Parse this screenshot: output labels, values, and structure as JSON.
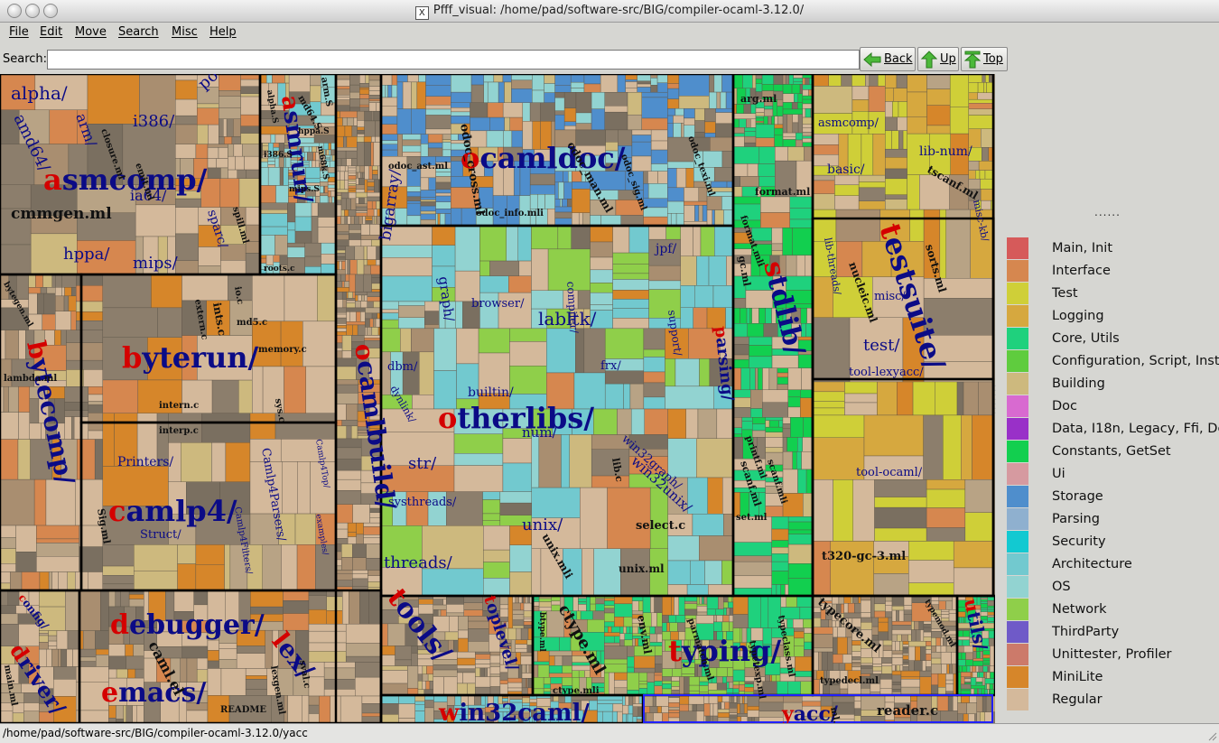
{
  "window": {
    "title": "Pfff_visual: /home/pad/software-src/BIG/compiler-ocaml-3.12.0/",
    "x_icon_glyph": "X"
  },
  "menubar": [
    "File",
    "Edit",
    "Move",
    "Search",
    "Misc",
    "Help"
  ],
  "toolbar": {
    "search_label": "Search:",
    "search_value": "",
    "back_label": "Back",
    "up_label": "Up",
    "top_label": "Top"
  },
  "colors": {
    "treemap_border": "#000000",
    "dir_label": "#0b0b86",
    "dir_initial": "#d40000",
    "selection_outline": "#2020ff"
  },
  "legend": {
    "dots": "......",
    "items": [
      {
        "label": "Main, Init",
        "color": "#d65a5a"
      },
      {
        "label": "Interface",
        "color": "#d6874f"
      },
      {
        "label": "Test",
        "color": "#cfcf38"
      },
      {
        "label": "Logging",
        "color": "#d6a83f"
      },
      {
        "label": "Core, Utils",
        "color": "#1fd17d"
      },
      {
        "label": "Configuration, Script, Install",
        "color": "#5fcc3e"
      },
      {
        "label": "Building",
        "color": "#cdb97e"
      },
      {
        "label": "Doc",
        "color": "#d86ad0"
      },
      {
        "label": "Data, I18n, Legacy, Ffi, Dead",
        "color": "#9930c8"
      },
      {
        "label": "Constants, GetSet",
        "color": "#12cf4f"
      },
      {
        "label": "Ui",
        "color": "#d69aa0"
      },
      {
        "label": "Storage",
        "color": "#4f8ecc"
      },
      {
        "label": "Parsing",
        "color": "#8fb0cf"
      },
      {
        "label": "Security",
        "color": "#12c9d1"
      },
      {
        "label": "Architecture",
        "color": "#72c9cf"
      },
      {
        "label": "OS",
        "color": "#92d3d1"
      },
      {
        "label": "Network",
        "color": "#8fcf4a"
      },
      {
        "label": "ThirdParty",
        "color": "#6f5ac8"
      },
      {
        "label": "Unittester, Profiler",
        "color": "#cc7a6a"
      },
      {
        "label": "MiniLite",
        "color": "#d6862a"
      },
      {
        "label": "Regular",
        "color": "#d4b99b"
      }
    ]
  },
  "treemap": {
    "directories": [
      {
        "label": "asmcomp/",
        "initial": "a",
        "rest": "smcomp/"
      },
      {
        "label": "bytecomp/",
        "initial": "b",
        "rest": "ytecomp/"
      },
      {
        "label": "byterun/",
        "initial": "b",
        "rest": "yterun/"
      },
      {
        "label": "camlp4/",
        "initial": "c",
        "rest": "amlp4/"
      },
      {
        "label": "debugger/",
        "initial": "d",
        "rest": "ebugger/"
      },
      {
        "label": "emacs/",
        "initial": "e",
        "rest": "macs/"
      },
      {
        "label": "ocamlbuild/",
        "initial": "o",
        "rest": "camlbuild/"
      },
      {
        "label": "ocamldoc/",
        "initial": "o",
        "rest": "camldoc/"
      },
      {
        "label": "otherlibs/",
        "initial": "o",
        "rest": "therlibs/"
      },
      {
        "label": "stdlib/",
        "initial": "s",
        "rest": "tdlib/"
      },
      {
        "label": "testsuite/",
        "initial": "t",
        "rest": "estsuite/"
      },
      {
        "label": "tools/",
        "initial": "t",
        "rest": "ools/"
      },
      {
        "label": "typing/",
        "initial": "t",
        "rest": "yping/"
      },
      {
        "label": "driver/",
        "initial": "d",
        "rest": "river/"
      },
      {
        "label": "lex/",
        "initial": "l",
        "rest": "ex/"
      },
      {
        "label": "toplevel/",
        "initial": "t",
        "rest": "oplevel/"
      },
      {
        "label": "utils/",
        "initial": "u",
        "rest": "tils/"
      },
      {
        "label": "win32caml/",
        "initial": "w",
        "rest": "in32caml/"
      },
      {
        "label": "yacc/",
        "initial": "y",
        "rest": "acc/"
      },
      {
        "label": "parsing/",
        "initial": "p",
        "rest": "arsing/"
      },
      {
        "label": "asmrun/",
        "initial": "a",
        "rest": "smrun/"
      },
      {
        "label": "config/",
        "initial": "c",
        "rest": "onfig/"
      }
    ],
    "subdirs": [
      "alpha/",
      "amd64/",
      "arm/",
      "i386/",
      "power/",
      "ia64/",
      "hppa/",
      "mips/",
      "sparc/",
      "bigarray/",
      "graph/",
      "dbm/",
      "dynlink/",
      "labltk/",
      "browser/",
      "compiler/",
      "jpf/",
      "support/",
      "frx/",
      "builtin/",
      "num/",
      "str/",
      "systhreads/",
      "threads/",
      "unix/",
      "win32unix/",
      "win32graph/",
      "lib-num/",
      "basic/",
      "asmcomp/",
      "lib-threads/",
      "misc-kb/",
      "tool-lexyacc/",
      "tool-ocaml/",
      "Camlp4Parsers/",
      "Camlp4Filters/",
      "Camlp4Top/",
      "Printers/",
      "Struct/",
      "examples/",
      "misc/",
      "test/"
    ],
    "files": [
      "cmmgen.ml",
      "closure.ml",
      "emit.ml",
      "spill.ml",
      "roots.c",
      "arm.S",
      "md64.S",
      "alpha.S",
      "hppa.S",
      "i386.S",
      "m68k.S",
      "mips.S",
      "odoc_ast.ml",
      "odoc_cross.ml",
      "odoc_info.mli",
      "odoc_man.ml",
      "odoc_sig.ml",
      "odoc_texi.ml",
      "interp.c",
      "intern.c",
      "ints.c",
      "md5.c",
      "memory.c",
      "sys.c",
      "extern.c",
      "io.c",
      "bytegen.ml",
      "lambda.ml",
      "Sig.ml",
      "select.c",
      "unix.ml",
      "unix.mli",
      "lib.c",
      "arg.ml",
      "format.ml",
      "format.mli",
      "gc.ml",
      "printf.ml",
      "scanf.ml",
      "scanf.mli",
      "set.ml",
      "tscanf.ml",
      "nucleic.ml",
      "sorts.ml",
      "t320-gc-3.ml",
      "ctype.ml",
      "ctype.mli",
      "btype.ml",
      "env.ml",
      "typecore.ml",
      "typedecl.ml",
      "typemod.ml",
      "typeclass.ml",
      "parmatch.ml",
      "typetexp.ml",
      "reader.c",
      "lexgen.ml",
      "main.ml",
      "README",
      "caml.el",
      "sval.c",
      "ml.c"
    ]
  },
  "status": {
    "path": "/home/pad/software-src/BIG/compiler-ocaml-3.12.0/yacc"
  }
}
